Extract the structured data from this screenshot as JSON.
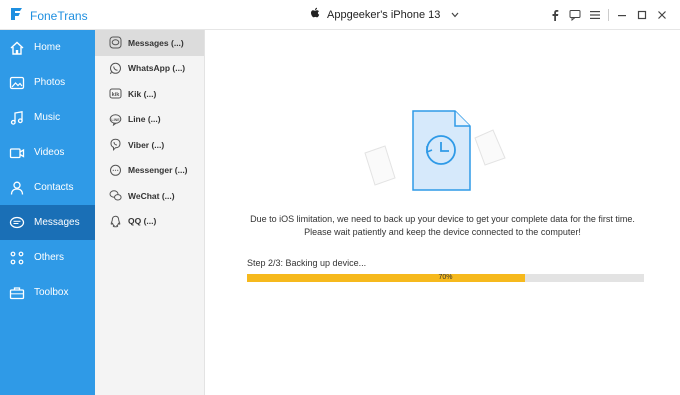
{
  "app": {
    "name": "FoneTrans"
  },
  "device": {
    "name": "Appgeeker's iPhone 13"
  },
  "window_controls": [
    "facebook-icon",
    "chat-icon",
    "menu-icon",
    "minimize-icon",
    "maximize-icon",
    "close-icon"
  ],
  "sidebar": {
    "items": [
      {
        "label": "Home",
        "icon": "home-icon"
      },
      {
        "label": "Photos",
        "icon": "photos-icon"
      },
      {
        "label": "Music",
        "icon": "music-icon"
      },
      {
        "label": "Videos",
        "icon": "videos-icon"
      },
      {
        "label": "Contacts",
        "icon": "contacts-icon"
      },
      {
        "label": "Messages",
        "icon": "messages-icon",
        "active": true
      },
      {
        "label": "Others",
        "icon": "others-icon"
      },
      {
        "label": "Toolbox",
        "icon": "toolbox-icon"
      }
    ]
  },
  "subpanel": {
    "items": [
      {
        "label": "Messages (...)",
        "icon": "messages-icon",
        "active": true
      },
      {
        "label": "WhatsApp (...)",
        "icon": "whatsapp-icon"
      },
      {
        "label": "Kik (...)",
        "icon": "kik-icon"
      },
      {
        "label": "Line (...)",
        "icon": "line-icon"
      },
      {
        "label": "Viber (...)",
        "icon": "viber-icon"
      },
      {
        "label": "Messenger (...)",
        "icon": "messenger-icon"
      },
      {
        "label": "WeChat (...)",
        "icon": "wechat-icon"
      },
      {
        "label": "QQ (...)",
        "icon": "qq-icon"
      }
    ]
  },
  "main": {
    "message_line1": "Due to iOS limitation, we need to back up your device to get your complete data for the first time.",
    "message_line2": "Please wait patiently and keep the device connected to the computer!",
    "step_text": "Step 2/3: Backing up device...",
    "progress": {
      "percent": 70,
      "label": "70%"
    }
  },
  "colors": {
    "sidebar": "#2f9ae7",
    "sidebar_active": "#1a6fb6",
    "progress": "#f6b91d",
    "accent": "#1e8fe0"
  }
}
